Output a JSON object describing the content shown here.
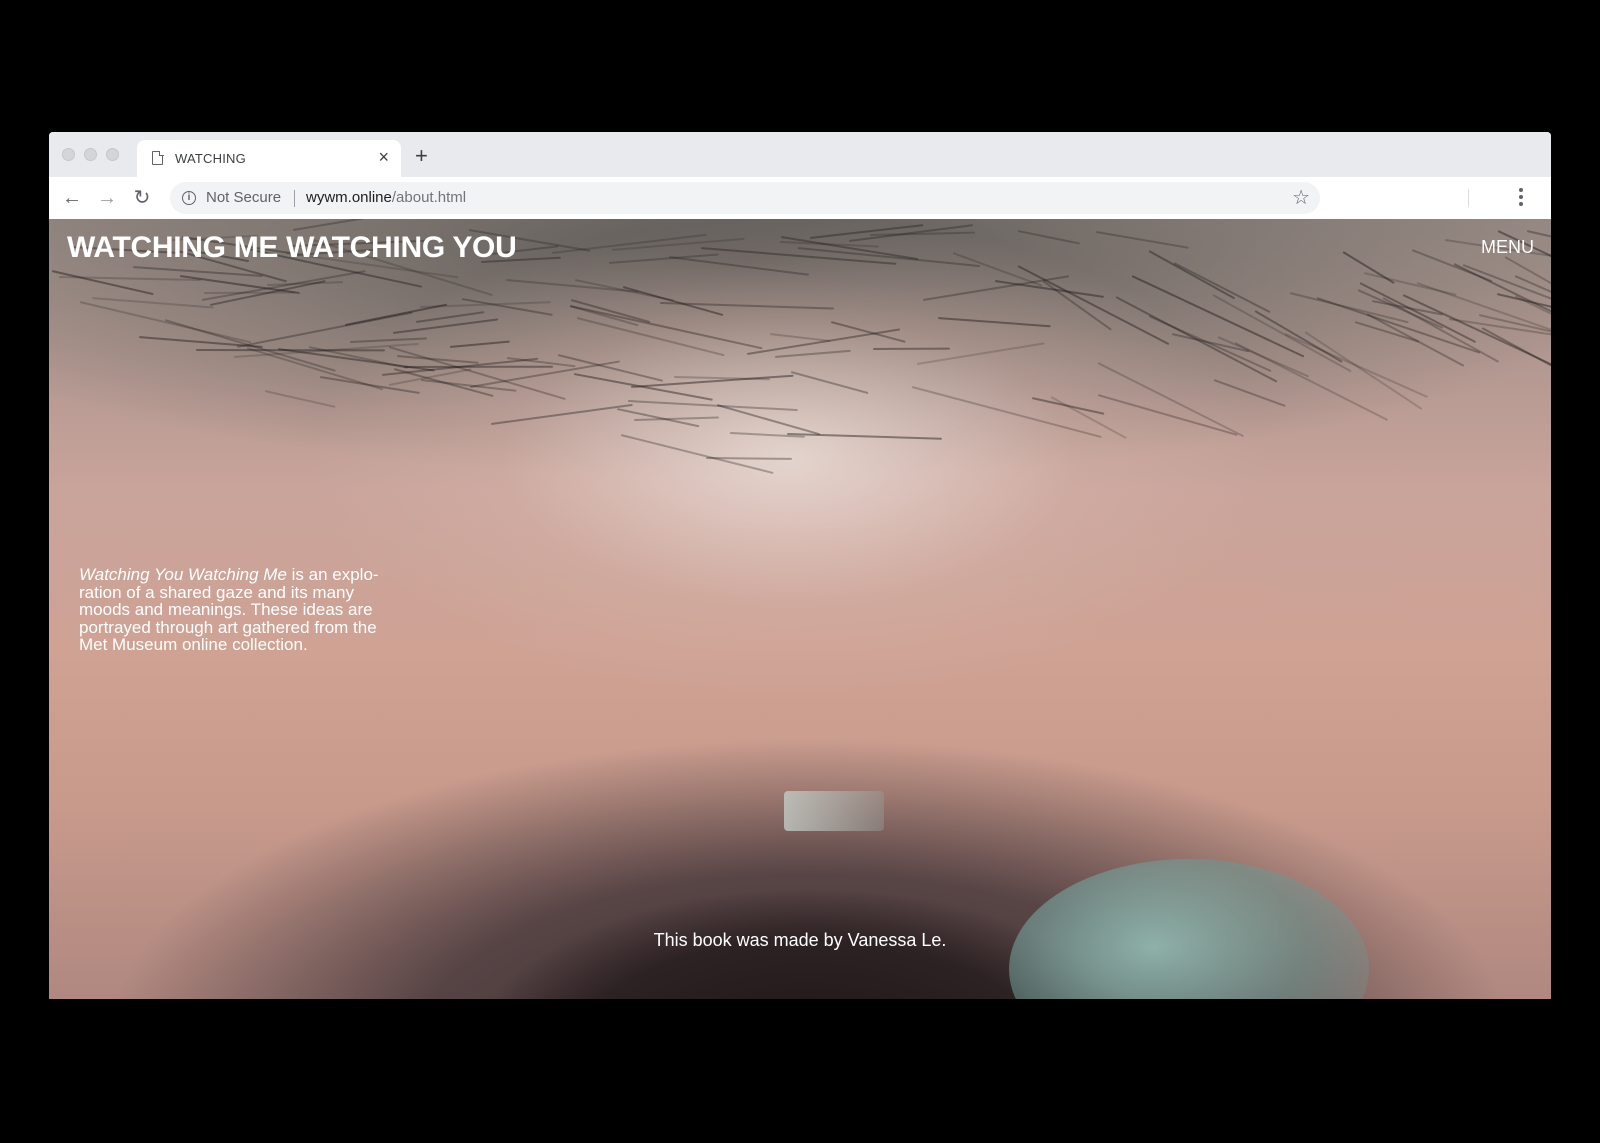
{
  "browser": {
    "tab_title": "WATCHING",
    "tab_close": "×",
    "new_tab": "+",
    "security_label": "Not Secure",
    "url_domain": "wywm.online",
    "url_path": "/about.html",
    "back_icon": "←",
    "forward_icon": "→",
    "reload_icon": "↻",
    "star_icon": "☆"
  },
  "page": {
    "site_title": "WATCHING ME WATCHING YOU",
    "menu_label": "MENU",
    "about_title_italic": "Watching You Watching Me",
    "about_rest": " is an explo-ration of a shared gaze and its many moods and meanings. These ideas are portrayed through art gathered from the Met Museum online collection.",
    "credit": "This book was made by Vanessa Le."
  },
  "colors": {
    "chrome_bg": "#e8eaed",
    "toolbar_bg": "#ffffff",
    "omnibox_bg": "#f1f3f4",
    "page_text": "#ffffff"
  }
}
